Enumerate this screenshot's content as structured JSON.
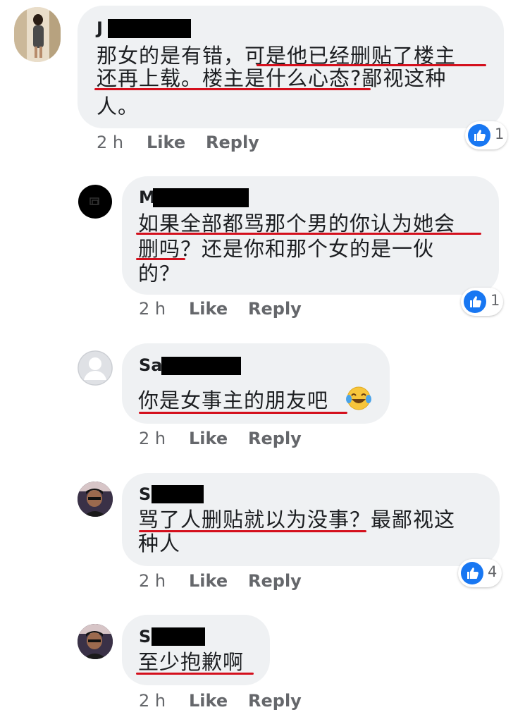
{
  "comments": [
    {
      "name": "J",
      "lines": [
        "那女的是有错，可是他已经删贴了楼主",
        "还再上载。楼主是什么心态?鄙视这种",
        "人。"
      ],
      "time": "2 h",
      "like": "Like",
      "reply": "Reply",
      "reactions": "1",
      "avatar": "woman-photo-avatar"
    },
    {
      "name": "M",
      "lines": [
        "如果全部都骂那个男的你认为她会",
        "删吗？还是你和那个女的是一伙",
        "的？"
      ],
      "time": "2 h",
      "like": "Like",
      "reply": "Reply",
      "reactions": "1",
      "avatar": "black-logo-avatar"
    },
    {
      "name": "Sa",
      "lines": [
        "你是女事主的朋友吧"
      ],
      "emoji": "laughing-tears-emoji",
      "time": "2 h",
      "like": "Like",
      "reply": "Reply",
      "avatar": "default-person-avatar"
    },
    {
      "name": "S",
      "lines": [
        "骂了人删贴就以为没事？最鄙视这",
        "种人"
      ],
      "time": "2 h",
      "like": "Like",
      "reply": "Reply",
      "reactions": "4",
      "avatar": "man-photo-avatar"
    },
    {
      "name": "S",
      "lines": [
        "至少抱歉啊"
      ],
      "time": "2 h",
      "like": "Like",
      "reply": "Reply",
      "avatar": "man-photo-avatar"
    }
  ],
  "colors": {
    "bubble": "#eff1f3",
    "underline": "#d40f1c",
    "like_blue": "#1877f2",
    "meta_gray": "#65676b"
  },
  "icons": [
    "like-thumb-icon"
  ]
}
